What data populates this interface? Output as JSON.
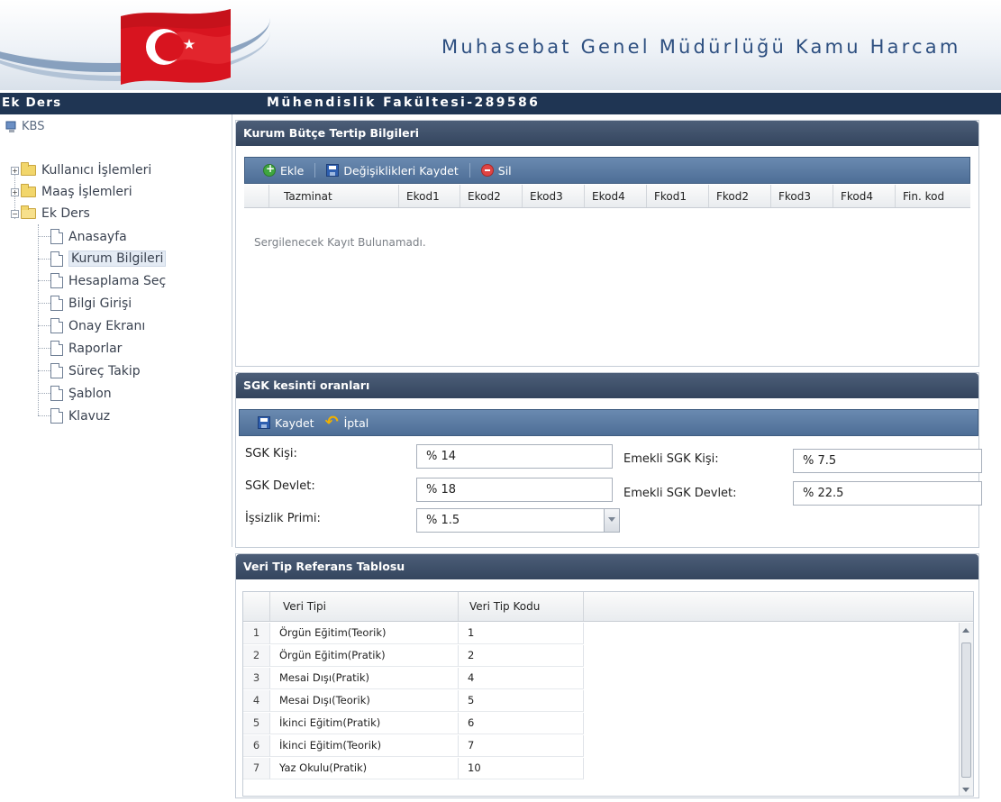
{
  "header": {
    "title": "Muhasebat Genel Müdürlüğü Kamu Harcam"
  },
  "subbar": {
    "left": "Ek Ders",
    "center": "Mühendislik Fakültesi-289586"
  },
  "sidebar": {
    "root": "KBS",
    "folders": [
      {
        "label": "Kullanıcı İşlemleri",
        "expanded": false
      },
      {
        "label": "Maaş İşlemleri",
        "expanded": false
      },
      {
        "label": "Ek Ders",
        "expanded": true
      }
    ],
    "items": [
      "Anasayfa",
      "Kurum Bilgileri",
      "Hesaplama Seç",
      "Bilgi Girişi",
      "Onay Ekranı",
      "Raporlar",
      "Süreç Takip",
      "Şablon",
      "Klavuz"
    ],
    "selected": "Kurum Bilgileri"
  },
  "kurum_panel": {
    "title": "Kurum Bütçe Tertip Bilgileri",
    "toolbar": {
      "add": "Ekle",
      "save": "Değişiklikleri Kaydet",
      "delete": "Sil"
    },
    "columns": [
      "Tazminat",
      "Ekod1",
      "Ekod2",
      "Ekod3",
      "Ekod4",
      "Fkod1",
      "Fkod2",
      "Fkod3",
      "Fkod4",
      "Fin. kod"
    ],
    "empty_message": "Sergilenecek Kayıt Bulunamadı."
  },
  "sgk_panel": {
    "title": "SGK kesinti oranları",
    "toolbar": {
      "save": "Kaydet",
      "cancel": "İptal"
    },
    "fields": {
      "sgk_kisi": {
        "label": "SGK Kişi:",
        "value": "% 14"
      },
      "sgk_devlet": {
        "label": "SGK Devlet:",
        "value": "% 18"
      },
      "issizlik": {
        "label": "İşsizlik Primi:",
        "value": "% 1.5"
      },
      "emekli_kisi": {
        "label": "Emekli SGK Kişi:",
        "value": "% 7.5"
      },
      "emekli_devlet": {
        "label": "Emekli SGK Devlet:",
        "value": "% 22.5"
      }
    }
  },
  "veri_panel": {
    "title": "Veri Tip Referans Tablosu",
    "columns": [
      "Veri Tipi",
      "Veri Tip Kodu"
    ],
    "rows": [
      {
        "n": "1",
        "tip": "Örgün Eğitim(Teorik)",
        "kod": "1"
      },
      {
        "n": "2",
        "tip": "Örgün Eğitim(Pratik)",
        "kod": "2"
      },
      {
        "n": "3",
        "tip": "Mesai Dışı(Pratik)",
        "kod": "4"
      },
      {
        "n": "4",
        "tip": "Mesai Dışı(Teorik)",
        "kod": "5"
      },
      {
        "n": "5",
        "tip": "İkinci Eğitim(Pratik)",
        "kod": "6"
      },
      {
        "n": "6",
        "tip": "İkinci Eğitim(Teorik)",
        "kod": "7"
      },
      {
        "n": "7",
        "tip": "Yaz Okulu(Pratik)",
        "kod": "10"
      }
    ]
  },
  "colors": {
    "navy": "#1f3553",
    "panel_header": "#3d4f69",
    "toolbar": "#5a7ba3",
    "header_text": "#2d4f80",
    "flag_red": "#d8141f"
  }
}
